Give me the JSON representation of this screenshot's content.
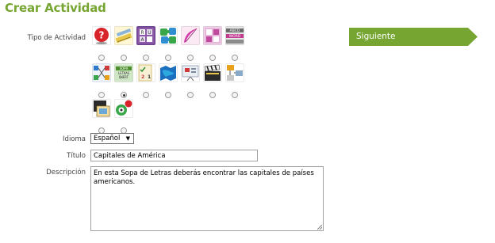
{
  "page": {
    "title": "Crear Actividad"
  },
  "form": {
    "activity_type_label": "Tipo de Actividad",
    "language_label": "Idioma",
    "language_value": "Español",
    "title_label": "Título",
    "title_value": "Capitales de América",
    "description_label": "Descripción",
    "description_value": "En esta Sopa de Letras deberás encontrar las capitales de países americanos."
  },
  "next_button": {
    "label": "Siguiente",
    "color": "#76a531"
  },
  "accent_color": "#76a531",
  "activity_types": [
    {
      "icon": "question-mark-icon",
      "selected": false
    },
    {
      "icon": "pencil-ruler-icon",
      "selected": false
    },
    {
      "icon": "letter-grid-icon",
      "selected": false
    },
    {
      "icon": "puzzle-pieces-icon",
      "selected": false
    },
    {
      "icon": "feather-pen-icon",
      "selected": false
    },
    {
      "icon": "grid-checkbox-icon",
      "selected": false
    },
    {
      "icon": "word-strips-icon",
      "selected": false
    },
    {
      "icon": "abc-columns-icon",
      "selected": false
    },
    {
      "icon": "word-search-icon",
      "selected": true
    },
    {
      "icon": "numbered-list-icon",
      "selected": false
    },
    {
      "icon": "globe-map-icon",
      "selected": false
    },
    {
      "icon": "presentation-board-icon",
      "selected": false
    },
    {
      "icon": "clapperboard-icon",
      "selected": false
    },
    {
      "icon": "flowchart-icon",
      "selected": false
    },
    {
      "icon": "photo-camera-icon",
      "selected": false
    },
    {
      "icon": "record-badge-icon",
      "selected": false
    }
  ]
}
